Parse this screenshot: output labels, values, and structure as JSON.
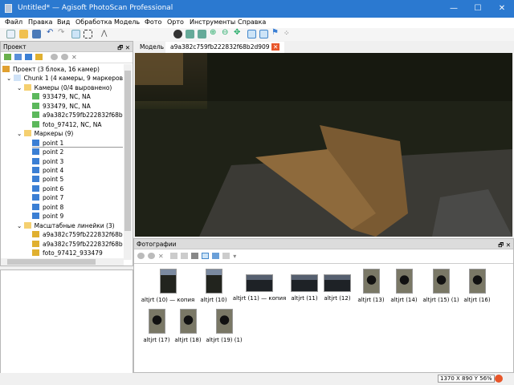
{
  "window": {
    "title": "Untitled* — Agisoft PhotoScan Professional",
    "min": "—",
    "max": "☐",
    "close": "✕"
  },
  "menu": [
    "Файл",
    "Правка",
    "Вид",
    "Обработка",
    "Модель",
    "Фото",
    "Орто",
    "Инструменты",
    "Справка"
  ],
  "project_panel": {
    "title": "Проект",
    "tree": [
      {
        "label": "Проект (3 блока, 16 камер)",
        "icon": "project-icon",
        "level": 0
      },
      {
        "label": "Chunk 1 (4 камеры, 9 маркеров)",
        "icon": "chunk-icon",
        "level": 1
      },
      {
        "label": "Камеры (0/4 выровнено)",
        "icon": "folder-icon",
        "level": 2
      },
      {
        "label": "933479, NC, NA",
        "icon": "camera-icon",
        "level": 3
      },
      {
        "label": "933479, NC, NA",
        "icon": "camera-icon",
        "level": 3
      },
      {
        "label": "a9a382c759fb222832f68b2d909",
        "icon": "camera-icon",
        "level": 3
      },
      {
        "label": "foto_97412, NC, NA",
        "icon": "camera-icon",
        "level": 3
      },
      {
        "label": "Маркеры (9)",
        "icon": "folder-icon",
        "level": 2
      },
      {
        "label": "point 1",
        "icon": "marker-icon",
        "level": 3
      },
      {
        "label": "point 2",
        "icon": "marker-icon",
        "level": 3
      },
      {
        "label": "point 3",
        "icon": "marker-icon",
        "level": 3
      },
      {
        "label": "point 4",
        "icon": "marker-icon",
        "level": 3
      },
      {
        "label": "point 5",
        "icon": "marker-icon",
        "level": 3
      },
      {
        "label": "point 6",
        "icon": "marker-icon",
        "level": 3
      },
      {
        "label": "point 7",
        "icon": "marker-icon",
        "level": 3
      },
      {
        "label": "point 8",
        "icon": "marker-icon",
        "level": 3
      },
      {
        "label": "point 9",
        "icon": "marker-icon",
        "level": 3
      },
      {
        "label": "Масштабные линейки (3)",
        "icon": "folder-icon",
        "level": 2
      },
      {
        "label": "a9a382c759fb222832f68b2d909",
        "icon": "scalebar-icon",
        "level": 3
      },
      {
        "label": "a9a382c759fb222832f68b2d909",
        "icon": "scalebar-icon",
        "level": 3
      },
      {
        "label": "foto_97412_933479",
        "icon": "scalebar-icon",
        "level": 3
      }
    ]
  },
  "tabs": [
    {
      "label": "Модель"
    },
    {
      "label": "a9a382c759fb222832f68b2d909",
      "active": true
    }
  ],
  "photos_panel": {
    "title": "Фотографии",
    "items": [
      {
        "label": "altjrt (10) — копия",
        "orient": "portrait"
      },
      {
        "label": "altjrt (10)",
        "orient": "portrait"
      },
      {
        "label": "altjrt (11) — копия",
        "orient": "landscape"
      },
      {
        "label": "altjrt (11)",
        "orient": "landscape"
      },
      {
        "label": "altjrt (12)",
        "orient": "landscape"
      },
      {
        "label": "altjrt (13)",
        "orient": "portrait"
      },
      {
        "label": "altjrt (14)",
        "orient": "portrait"
      },
      {
        "label": "altjrt (15) (1)",
        "orient": "portrait"
      },
      {
        "label": "altjrt (16)",
        "orient": "portrait"
      },
      {
        "label": "altjrt (17)",
        "orient": "portrait"
      },
      {
        "label": "altjrt (18)",
        "orient": "portrait"
      },
      {
        "label": "altjrt (19) (1)",
        "orient": "portrait"
      }
    ]
  },
  "status": {
    "coords": "1370 X  890 Y  56%"
  },
  "colors": {
    "titlebar": "#2b79d0",
    "tab_close": "#e8562a",
    "marker": "#3b7fd4"
  }
}
